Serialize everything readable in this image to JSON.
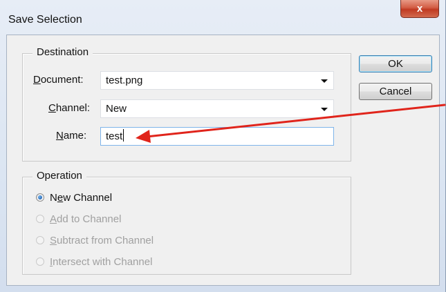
{
  "window": {
    "title": "Save Selection",
    "close_glyph": "x"
  },
  "destination": {
    "group_label": "Destination",
    "document_label": "Document:",
    "document_value": "test.png",
    "channel_label": "Channel:",
    "channel_value": "New",
    "name_label": "Name:",
    "name_value": "test"
  },
  "buttons": {
    "ok": "OK",
    "cancel": "Cancel"
  },
  "operation": {
    "group_label": "Operation",
    "options": [
      {
        "label": "New Channel",
        "selected": true,
        "enabled": true
      },
      {
        "label": "Add to Channel",
        "selected": false,
        "enabled": false
      },
      {
        "label": "Subtract from Channel",
        "selected": false,
        "enabled": false
      },
      {
        "label": "Intersect with Channel",
        "selected": false,
        "enabled": false
      }
    ]
  },
  "annotation": {
    "color": "#e0241b"
  },
  "icons": {
    "dropdown": "chevron-down-icon",
    "radio_selected": "radio-selected-icon"
  }
}
